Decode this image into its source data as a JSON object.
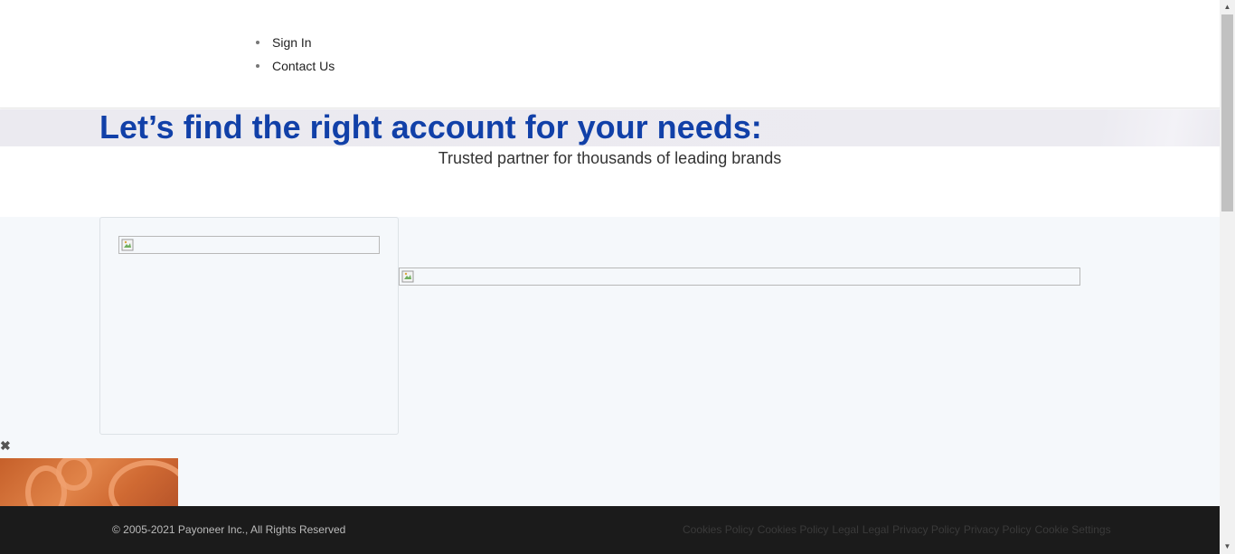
{
  "nav": {
    "items": [
      {
        "label": "Sign In"
      },
      {
        "label": "Contact Us"
      }
    ]
  },
  "hero": {
    "title": "Let’s find the right account for your needs:",
    "subtitle": "Trusted partner for thousands of leading brands"
  },
  "close_glyph": "✖",
  "footer": {
    "copyright": "© 2005-2021 Payoneer Inc., All Rights Reserved",
    "links": [
      {
        "label": "Cookies Policy"
      },
      {
        "label": "Cookies Policy"
      },
      {
        "label": "Legal"
      },
      {
        "label": "Legal"
      },
      {
        "label": "Privacy Policy"
      },
      {
        "label": "Privacy Policy"
      },
      {
        "label": "Cookie Settings"
      }
    ]
  },
  "colors": {
    "title": "#1140a8",
    "footer_bg": "#1b1b1b",
    "content_bg": "#f5f8fb"
  }
}
